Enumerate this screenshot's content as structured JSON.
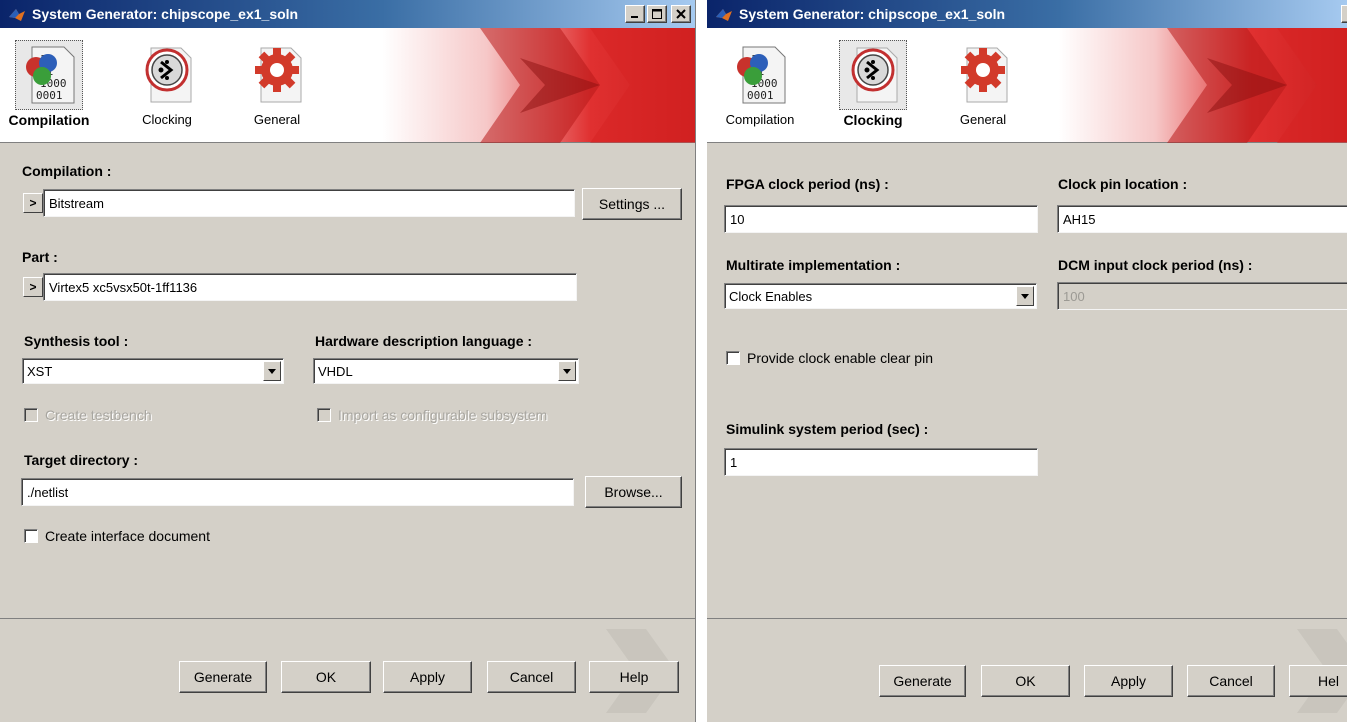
{
  "windows": {
    "left": {
      "title": "System Generator: chipscope_ex1_soln",
      "tabs": [
        {
          "label": "Compilation",
          "active": true
        },
        {
          "label": "Clocking",
          "active": false
        },
        {
          "label": "General",
          "active": false
        }
      ],
      "compilation": {
        "label": "Compilation :",
        "expander": ">",
        "value": "Bitstream",
        "settings_button": "Settings ..."
      },
      "part": {
        "label": "Part :",
        "expander": ">",
        "value": "Virtex5  xc5vsx50t-1ff1136"
      },
      "synthesis_tool": {
        "label": "Synthesis tool :",
        "value": "XST"
      },
      "hdl": {
        "label": "Hardware description language :",
        "value": "VHDL"
      },
      "create_testbench": {
        "label": "Create testbench",
        "checked": false,
        "enabled": false
      },
      "import_subsystem": {
        "label": "Import as configurable subsystem",
        "checked": false,
        "enabled": false
      },
      "target_directory": {
        "label": "Target directory :",
        "value": "./netlist",
        "browse_button": "Browse..."
      },
      "interface_doc": {
        "label": "Create interface document",
        "checked": false,
        "enabled": true
      },
      "buttons": {
        "generate": "Generate",
        "ok": "OK",
        "apply": "Apply",
        "cancel": "Cancel",
        "help": "Help"
      }
    },
    "right": {
      "title": "System Generator: chipscope_ex1_soln",
      "tabs": [
        {
          "label": "Compilation",
          "active": false
        },
        {
          "label": "Clocking",
          "active": true
        },
        {
          "label": "General",
          "active": false
        }
      ],
      "fpga_clock_period": {
        "label": "FPGA clock period (ns) :",
        "value": "10"
      },
      "clock_pin": {
        "label": "Clock pin location :",
        "value": "AH15"
      },
      "multirate": {
        "label": "Multirate implementation :",
        "value": "Clock Enables"
      },
      "dcm_period": {
        "label": "DCM input clock period (ns) :",
        "value": "100",
        "enabled": false
      },
      "clock_enable_clear": {
        "label": "Provide clock enable clear pin",
        "checked": false,
        "enabled": true
      },
      "simulink_period": {
        "label": "Simulink system period (sec) :",
        "value": "1"
      },
      "buttons": {
        "generate": "Generate",
        "ok": "OK",
        "apply": "Apply",
        "cancel": "Cancel",
        "help": "Hel"
      }
    }
  },
  "icons": {
    "app": "matlab-logo-icon",
    "compilation": "binary-file-icon",
    "clocking": "clock-icon",
    "general": "gear-icon",
    "minimize": "minimize-icon",
    "maximize": "maximize-icon",
    "close": "close-icon",
    "dropdown": "chevron-down-icon"
  },
  "colors": {
    "title_bar_start": "#0a246a",
    "title_bar_end": "#a6caf0",
    "brand_red": "#cc1f1f",
    "dialog_face": "#d4d0c8"
  }
}
